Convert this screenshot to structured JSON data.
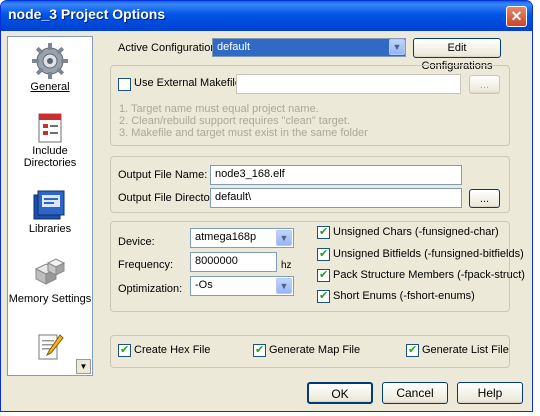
{
  "window": {
    "title": "node_3 Project Options",
    "close_glyph": "✕"
  },
  "sidebar": {
    "items": [
      {
        "label": "General",
        "icon": "gear-icon"
      },
      {
        "label": "Include Directories",
        "icon": "include-directories-icon"
      },
      {
        "label": "Libraries",
        "icon": "libraries-icon"
      },
      {
        "label": "Memory Settings",
        "icon": "memory-settings-icon"
      },
      {
        "label": "",
        "icon": "notepad-pencil-icon"
      }
    ],
    "scroll_glyph": "▼"
  },
  "config": {
    "label": "Active Configuration",
    "value": "default",
    "edit_button": "Edit Configurations"
  },
  "makefile": {
    "checkbox_label": "Use External Makefile",
    "checked": false,
    "path": "",
    "browse": "...",
    "notes": [
      "1. Target name must equal project name.",
      "2. Clean/rebuild support requires \"clean\" target.",
      "3. Makefile and target must exist in the same folder"
    ]
  },
  "output": {
    "file_label": "Output File Name:",
    "file_value": "node3_168.elf",
    "dir_label": "Output File Directory:",
    "dir_value": "default\\",
    "browse": "..."
  },
  "device": {
    "device_label": "Device:",
    "device_value": "atmega168p",
    "freq_label": "Frequency:",
    "freq_value": "8000000",
    "freq_unit": "hz",
    "opt_label": "Optimization:",
    "opt_value": "-Os"
  },
  "flags": [
    {
      "label": "Unsigned Chars (-funsigned-char)",
      "checked": true
    },
    {
      "label": "Unsigned Bitfields (-funsigned-bitfields)",
      "checked": true
    },
    {
      "label": "Pack Structure Members (-fpack-struct)",
      "checked": true
    },
    {
      "label": "Short Enums (-fshort-enums)",
      "checked": true
    }
  ],
  "outputs": [
    {
      "label": "Create Hex File",
      "checked": true
    },
    {
      "label": "Generate Map File",
      "checked": true
    },
    {
      "label": "Generate List File",
      "checked": true
    }
  ],
  "buttons": {
    "ok": "OK",
    "cancel": "Cancel",
    "help": "Help"
  }
}
